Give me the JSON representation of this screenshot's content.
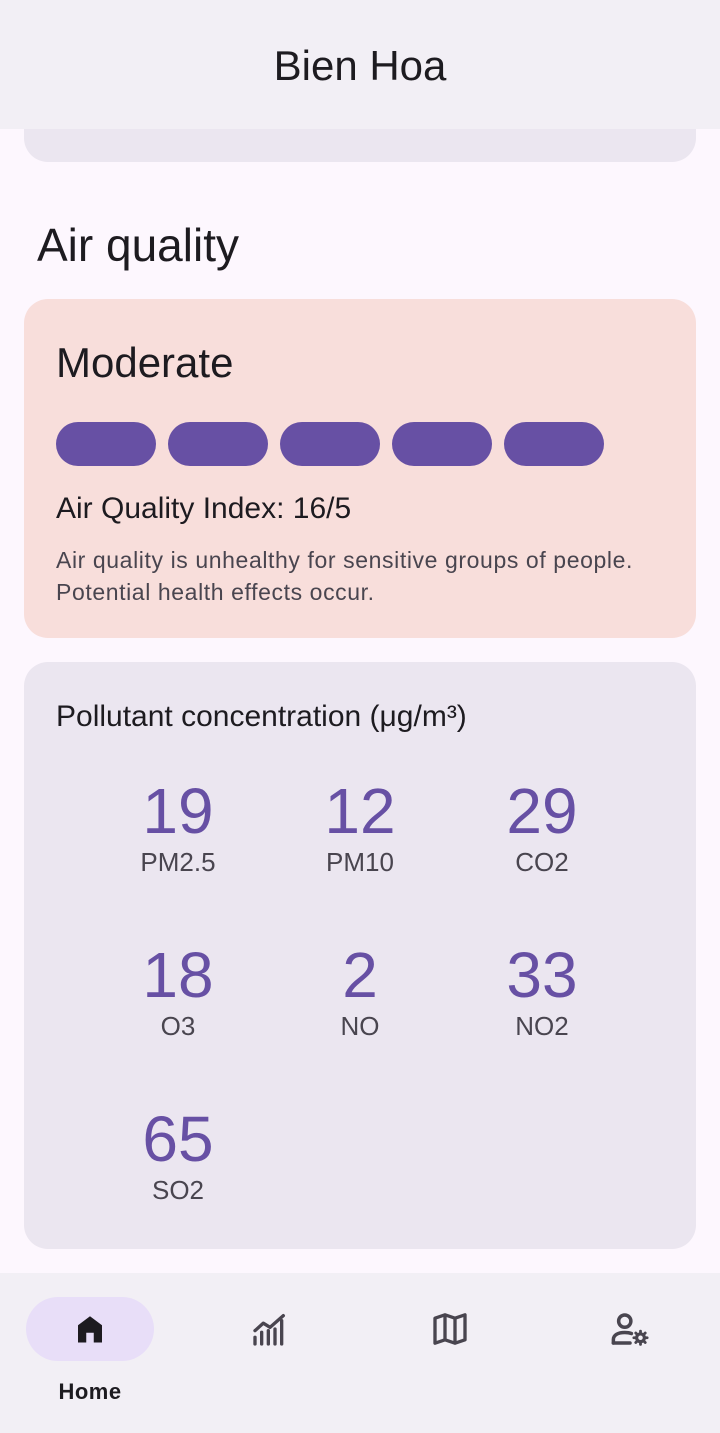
{
  "header": {
    "title": "Bien Hoa"
  },
  "air_quality": {
    "section_title": "Air quality",
    "level": "Moderate",
    "level_segments_filled": 5,
    "level_segments_total": 5,
    "index_text": "Air Quality Index: 16/5",
    "description": "Air quality is unhealthy for sensitive groups of people. Potential health effects occur."
  },
  "pollutants": {
    "heading": "Pollutant concentration (μg/m³)",
    "items": [
      {
        "value": "19",
        "name": "PM2.5"
      },
      {
        "value": "12",
        "name": "PM10"
      },
      {
        "value": "29",
        "name": "CO2"
      },
      {
        "value": "18",
        "name": "O3"
      },
      {
        "value": "2",
        "name": "NO"
      },
      {
        "value": "33",
        "name": "NO2"
      },
      {
        "value": "65",
        "name": "SO2"
      }
    ]
  },
  "nav": {
    "items": [
      {
        "label": "Home",
        "icon": "home-icon",
        "active": true
      },
      {
        "label": "",
        "icon": "chart-icon",
        "active": false
      },
      {
        "label": "",
        "icon": "map-icon",
        "active": false
      },
      {
        "label": "",
        "icon": "user-settings-icon",
        "active": false
      }
    ]
  },
  "colors": {
    "accent": "#6750a4",
    "aqi_card_bg": "#f8dedb",
    "card_bg": "#ebe6f0",
    "bar_bg": "#f2eff5",
    "nav_indicator": "#e8def8"
  }
}
